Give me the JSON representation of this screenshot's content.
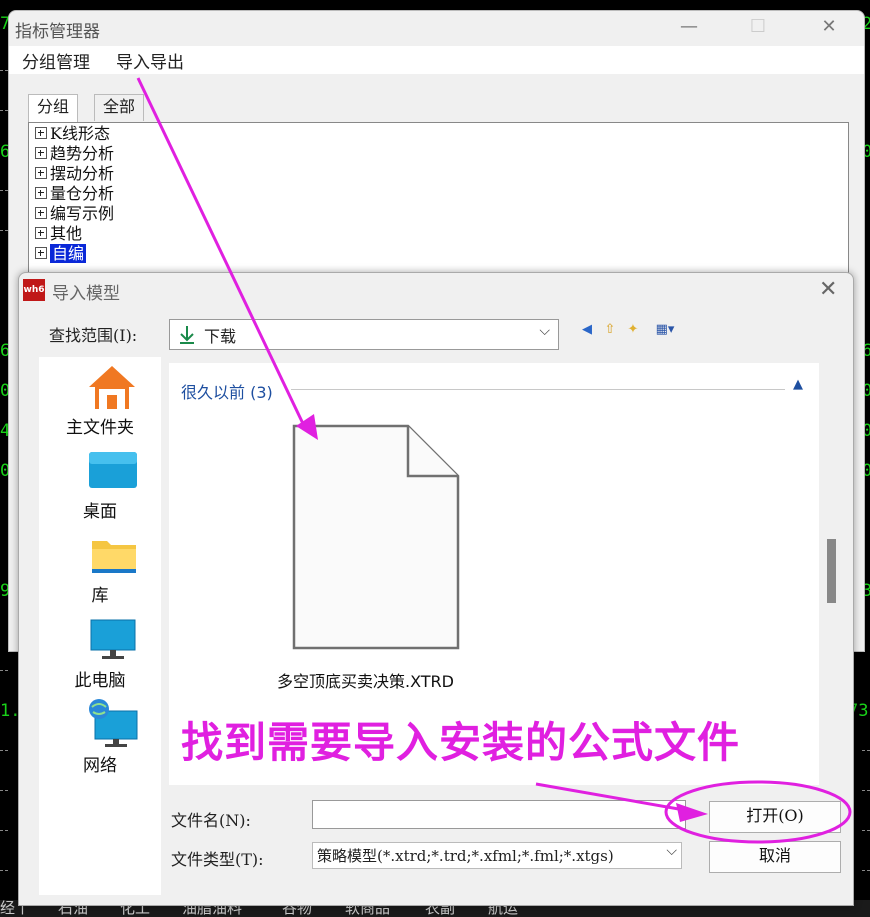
{
  "background": {
    "left_numbers": [
      "7",
      "6",
      "6",
      "0",
      "4",
      "0",
      "9",
      "1.8"
    ],
    "right_numbers": [
      "2",
      "0",
      "6",
      "0",
      "0",
      "0",
      "3",
      "73"
    ],
    "bottom_tabs": [
      "经丨",
      "石油",
      "化工",
      "油脂油料",
      "谷物",
      "软商品",
      "农副",
      "航运"
    ]
  },
  "manager": {
    "title": "指标管理器",
    "controls": {
      "minimize": "—",
      "maximize": "☐",
      "close": "✕"
    },
    "menu": [
      "分组管理",
      "导入导出"
    ],
    "tabs": [
      "分组",
      "全部"
    ],
    "tree": [
      "K线形态",
      "趋势分析",
      "摆动分析",
      "量仓分析",
      "编写示例",
      "其他",
      "自编"
    ]
  },
  "dialog": {
    "logo": "wh6",
    "title": "导入模型",
    "close": "✕",
    "look_in_label": "查找范围(I):",
    "look_in_value": "下载",
    "places": [
      "主文件夹",
      "桌面",
      "库",
      "此电脑",
      "网络"
    ],
    "group_header": "很久以前 (3)",
    "file": {
      "name": "多空顶底买卖决策.XTRD",
      "icon": "file-icon"
    },
    "annotation": "找到需要导入安装的公式文件",
    "filename_label": "文件名(N):",
    "filename_value": "",
    "filetype_label": "文件类型(T):",
    "filetype_value": "策略模型(*.xtrd;*.trd;*.xfml;*.fml;*.xtgs)",
    "open_button": "打开(O)",
    "cancel_button": "取消"
  },
  "colors": {
    "annotation": "#e020e0",
    "selection": "#0a28d8",
    "link_blue": "#1e4fa0",
    "chart_green": "#19d219"
  }
}
